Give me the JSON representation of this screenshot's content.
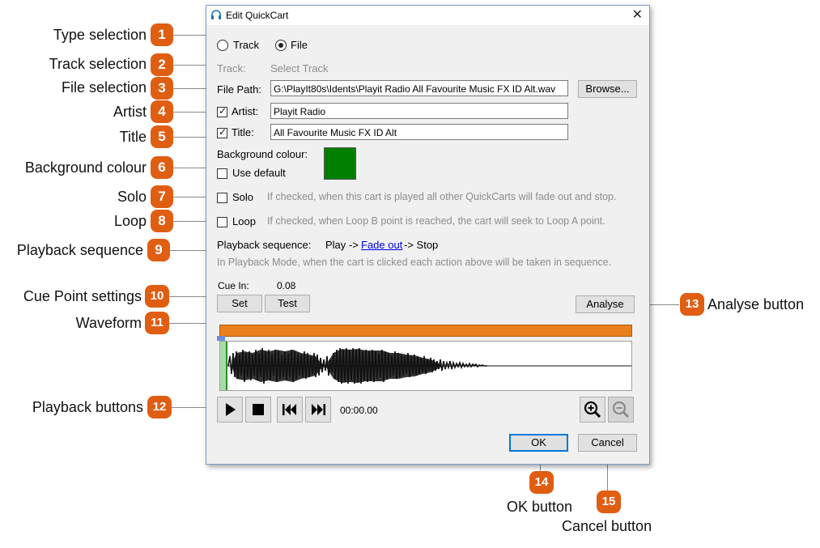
{
  "callouts": [
    {
      "num": "1",
      "label": "Type selection"
    },
    {
      "num": "2",
      "label": "Track selection"
    },
    {
      "num": "3",
      "label": "File selection"
    },
    {
      "num": "4",
      "label": "Artist"
    },
    {
      "num": "5",
      "label": "Title"
    },
    {
      "num": "6",
      "label": "Background colour"
    },
    {
      "num": "7",
      "label": "Solo"
    },
    {
      "num": "8",
      "label": "Loop"
    },
    {
      "num": "9",
      "label": "Playback sequence"
    },
    {
      "num": "10",
      "label": "Cue Point settings"
    },
    {
      "num": "11",
      "label": "Waveform"
    },
    {
      "num": "12",
      "label": "Playback buttons"
    },
    {
      "num": "13",
      "label": "Analyse button"
    },
    {
      "num": "14",
      "label": "OK button"
    },
    {
      "num": "15",
      "label": "Cancel button"
    }
  ],
  "dialog": {
    "title": "Edit QuickCart",
    "type_options": [
      {
        "label": "Track",
        "selected": false
      },
      {
        "label": "File",
        "selected": true
      }
    ],
    "track_label": "Track:",
    "track_value": "Select Track",
    "file_path_label": "File Path:",
    "file_path_value": "G:\\PlayIt80s\\Idents\\Playit Radio All Favourite Music FX ID Alt.wav",
    "browse_label": "Browse...",
    "artist_label": "Artist:",
    "artist_checked": true,
    "artist_value": "Playit Radio",
    "title_label": "Title:",
    "title_checked": true,
    "title_value": "All Favourite Music FX ID Alt",
    "bg_colour_label": "Background colour:",
    "use_default_label": "Use default",
    "use_default_checked": false,
    "bg_colour": "#008000",
    "solo_label": "Solo",
    "solo_checked": false,
    "solo_help": "If checked, when this cart is played all other QuickCarts will fade out and stop.",
    "loop_label": "Loop",
    "loop_checked": false,
    "loop_help": "If checked, when Loop B point is reached, the cart will seek to Loop A point.",
    "playback_seq_label": "Playback sequence:",
    "seq_play": "Play ->",
    "seq_fade": "Fade out",
    "seq_stop": "-> Stop",
    "playback_help": "In Playback Mode, when the cart is clicked each action above will be taken in sequence.",
    "cue_in_label": "Cue In:",
    "cue_in_value": "0.08",
    "set_label": "Set",
    "test_label": "Test",
    "analyse_label": "Analyse",
    "time_display": "00:00.00",
    "ok_label": "OK",
    "cancel_label": "Cancel",
    "accent_orange": "#e8801c",
    "cue_marker_color": "#2e8b2e"
  }
}
